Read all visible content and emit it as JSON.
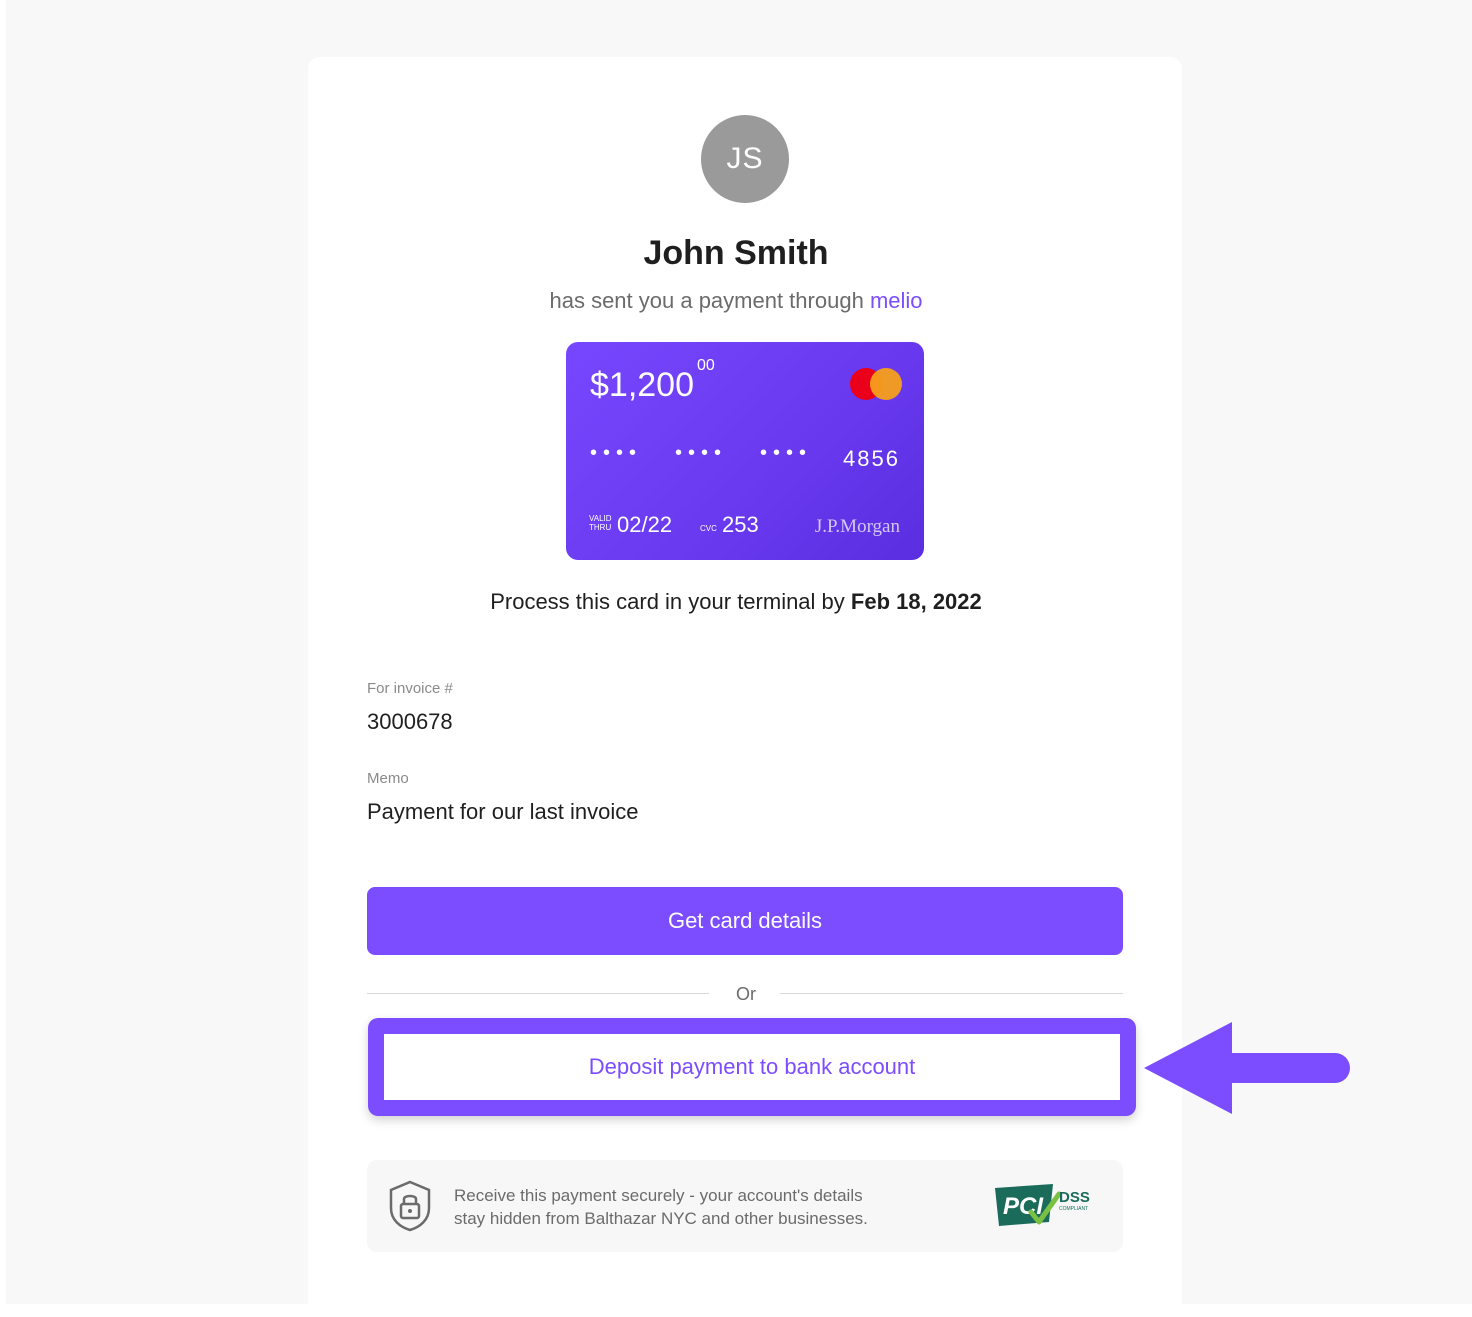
{
  "sender": {
    "initials": "JS",
    "name": "John Smith",
    "sent_text": "has sent you a payment through",
    "brand": "melio"
  },
  "card": {
    "amount": "$1,200",
    "cents": "00",
    "mask_group": "••••",
    "last4": "4856",
    "valid_label_1": "VALID",
    "valid_label_2": "THRU",
    "expiry": "02/22",
    "cvc_label": "CVC",
    "cvc": "253",
    "bank": "J.P.Morgan",
    "network_icon": "mastercard-icon",
    "gradient_colors": [
      "#7747ff",
      "#5a2ee0"
    ]
  },
  "process": {
    "text": "Process this card in your terminal by",
    "deadline": "Feb 18, 2022"
  },
  "invoice": {
    "label": "For invoice #",
    "value": "3000678"
  },
  "memo": {
    "label": "Memo",
    "value": "Payment for our last invoice"
  },
  "actions": {
    "primary_label": "Get card details",
    "or_label": "Or",
    "secondary_label": "Deposit payment to bank account"
  },
  "security": {
    "line1": "Receive this payment securely - your account's details",
    "line2": "stay hidden from Balthazar NYC and other businesses.",
    "icon": "shield-lock-icon",
    "badge_main": "PCI",
    "badge_dss": "DSS",
    "badge_sub": "COMPLIANT"
  },
  "colors": {
    "accent": "#7c4dff",
    "avatar_bg": "#9a9a9a",
    "pci_green": "#1a6b5a"
  }
}
